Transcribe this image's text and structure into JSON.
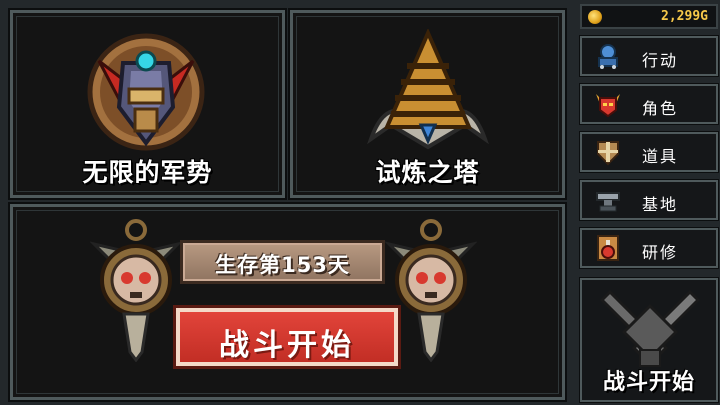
{
  "currency": {
    "gold": "2,299G"
  },
  "modes": {
    "infinite_army": {
      "title": "无限的军势",
      "icon": "horned-mask-emblem-icon"
    },
    "trial_tower": {
      "title": "试炼之塔",
      "icon": "tower-emblem-icon"
    }
  },
  "battle": {
    "day_text": "生存第153天",
    "start_label": "战斗开始"
  },
  "menu": {
    "items": [
      {
        "label": "行动",
        "icon": "action-icon"
      },
      {
        "label": "角色",
        "icon": "demon-helmet-icon"
      },
      {
        "label": "道具",
        "icon": "shield-icon"
      },
      {
        "label": "基地",
        "icon": "anvil-icon"
      },
      {
        "label": "研修",
        "icon": "potion-icon"
      }
    ],
    "battle_label": "战斗开始"
  },
  "colors": {
    "accent_red": "#d8392f",
    "gold": "#f7c94a",
    "panel_border": "#4f5a5c"
  }
}
